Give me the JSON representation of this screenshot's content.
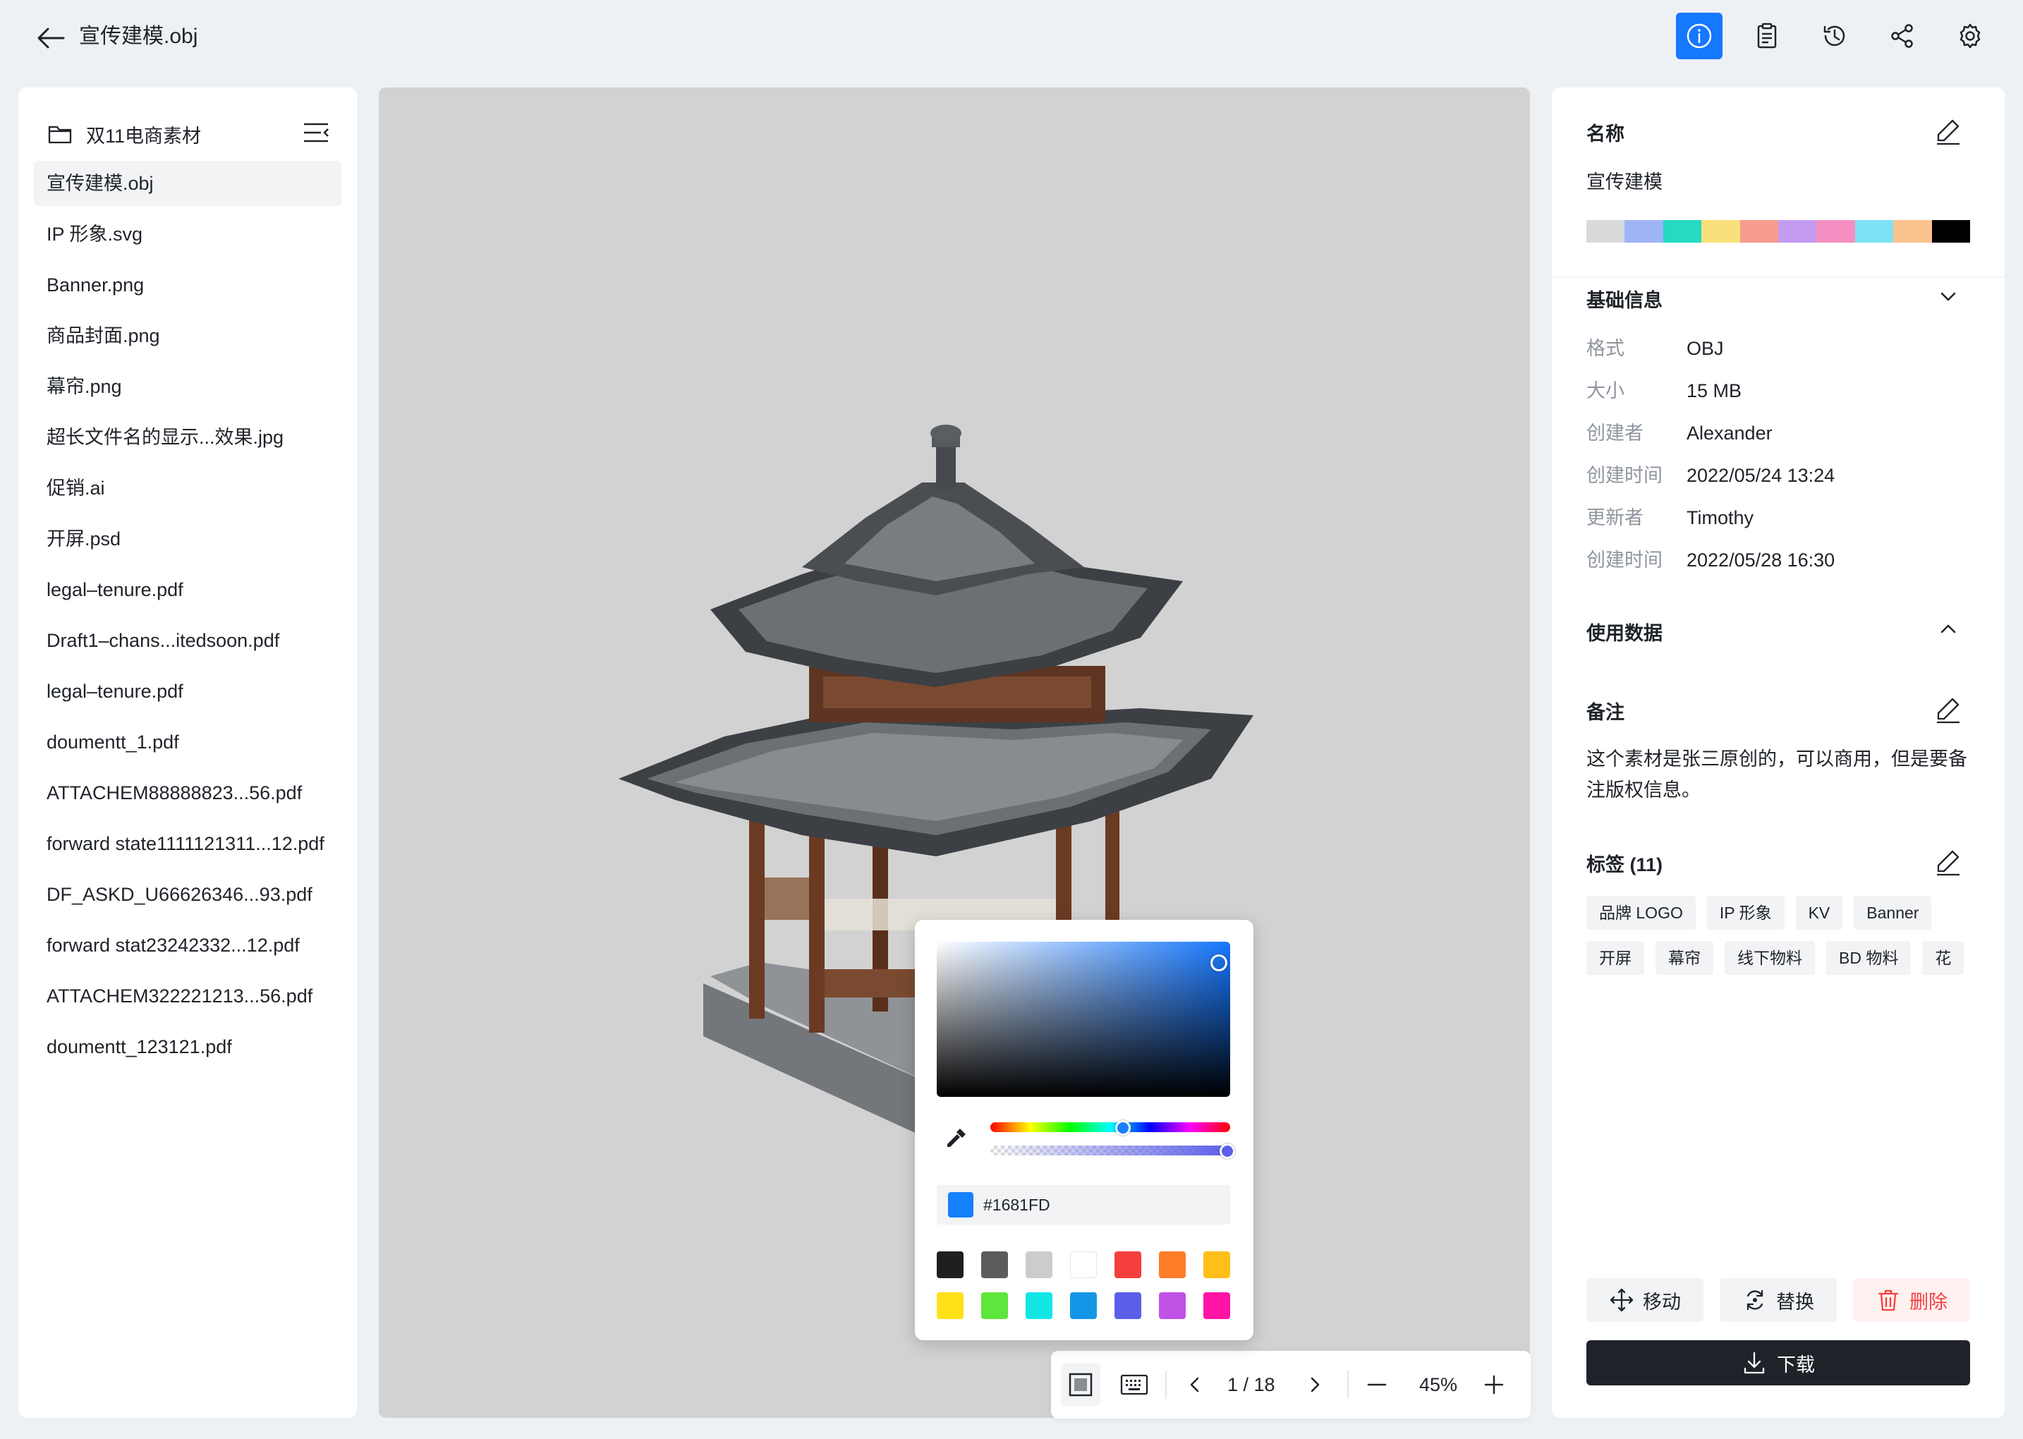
{
  "header": {
    "title": "宣传建模.obj"
  },
  "sidebar": {
    "folder": "双11电商素材",
    "files": [
      "宣传建模.obj",
      "IP 形象.svg",
      "Banner.png",
      "商品封面.png",
      "幕帘.png",
      "超长文件名的显示...效果.jpg",
      "促销.ai",
      "开屏.psd",
      "legal–tenure.pdf",
      "Draft1–chans...itedsoon.pdf",
      "legal–tenure.pdf",
      "doumentt_1.pdf",
      "ATTACHEM88888823...56.pdf",
      "forward state1111121311...12.pdf",
      "DF_ASKD_U66626346...93.pdf",
      "forward stat23242332...12.pdf",
      "ATTACHEM322221213...56.pdf",
      "doumentt_123121.pdf"
    ],
    "active_index": 0
  },
  "details": {
    "name_label": "名称",
    "name_value": "宣传建模",
    "palette": [
      "#d9dadb",
      "#9fb4f5",
      "#25d9c3",
      "#f9e07a",
      "#f79c8e",
      "#c39cf2",
      "#f58fc1",
      "#7ee3f5",
      "#f9c28e",
      "#000000"
    ],
    "basic_info_title": "基础信息",
    "basic_info": [
      {
        "label": "格式",
        "value": "OBJ"
      },
      {
        "label": "大小",
        "value": "15 MB"
      },
      {
        "label": "创建者",
        "value": "Alexander"
      },
      {
        "label": "创建时间",
        "value": "2022/05/24 13:24"
      },
      {
        "label": "更新者",
        "value": "Timothy"
      },
      {
        "label": "创建时间",
        "value": "2022/05/28 16:30"
      }
    ],
    "usage_title": "使用数据",
    "notes_title": "备注",
    "notes_text": "这个素材是张三原创的，可以商用，但是要备注版权信息。",
    "tags_title": "标签 (11)",
    "tags": [
      "品牌 LOGO",
      "IP 形象",
      "KV",
      "Banner",
      "开屏",
      "幕帘",
      "线下物料",
      "BD 物料",
      "花"
    ],
    "actions": {
      "move": "移动",
      "replace": "替换",
      "delete": "删除",
      "download": "下载"
    }
  },
  "color_picker": {
    "hex": "#1681FD",
    "current_color": "#1681FD",
    "presets_row1": [
      "#1f1f1f",
      "#5c5c5c",
      "#cccccc",
      "#ffffff",
      "#f53f3f",
      "#ff7d26",
      "#ffbe1a"
    ],
    "presets_row2": [
      "#ffe11a",
      "#5ee63c",
      "#14e6e6",
      "#1496e6",
      "#5b5fe8",
      "#c052e6",
      "#ff14a5"
    ]
  },
  "viewer_toolbar": {
    "page": "1 / 18",
    "zoom": "45%"
  },
  "colors": {
    "accent": "#1677ff",
    "danger": "#f53f3f"
  }
}
